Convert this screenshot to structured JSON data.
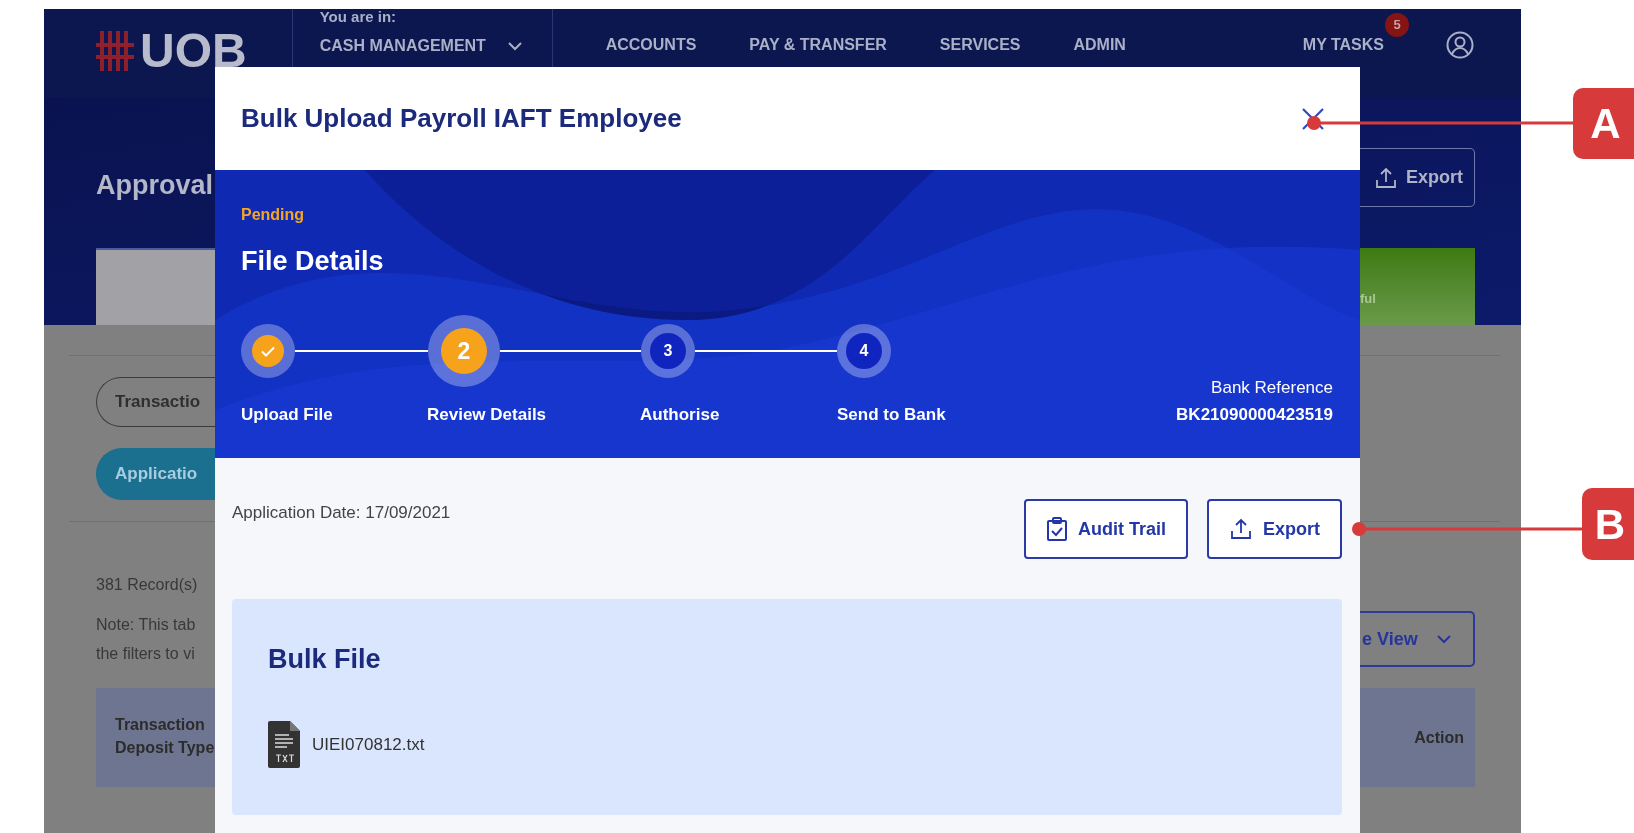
{
  "nav": {
    "logo": "UOB",
    "context_label": "You are in:",
    "context_value": "CASH MANAGEMENT",
    "menu": [
      "ACCOUNTS",
      "PAY & TRANSFER",
      "SERVICES",
      "ADMIN"
    ],
    "tasks": {
      "label": "MY TASKS",
      "count": "5"
    }
  },
  "background_page": {
    "title": "Approval",
    "export_button": "Export",
    "status_card": "ful",
    "tabs": [
      {
        "label": "Transactio",
        "selected": false
      },
      {
        "label": "Applicatio",
        "selected": true
      }
    ],
    "record_count": "381 Record(s)",
    "note_lines": [
      "Note: This tab",
      "the filters to vi"
    ],
    "view_dropdown": "e View",
    "table_header_left": [
      "Transaction",
      "Deposit Type"
    ],
    "table_header_right": "Action"
  },
  "modal": {
    "title": "Bulk Upload Payroll IAFT Employee",
    "status": "Pending",
    "heading": "File Details",
    "steps": [
      {
        "label": "Upload File",
        "completed": true,
        "current": false
      },
      {
        "label": "Review Details",
        "completed": false,
        "current": true,
        "number": "2"
      },
      {
        "label": "Authorise",
        "completed": false,
        "current": false,
        "number": "3"
      },
      {
        "label": "Send to Bank",
        "completed": false,
        "current": false,
        "number": "4"
      }
    ],
    "bank_reference": {
      "label": "Bank Reference",
      "value": "BK21090000423519"
    },
    "application_date": "Application Date: 17/09/2021",
    "buttons": [
      {
        "label": "Audit Trail",
        "kind": "audit"
      },
      {
        "label": "Export",
        "kind": "export"
      }
    ],
    "bulk_file": {
      "heading": "Bulk File",
      "file_name": "UIEI070812.txt"
    }
  },
  "callouts": [
    {
      "label": "A"
    },
    {
      "label": "B"
    }
  ]
}
